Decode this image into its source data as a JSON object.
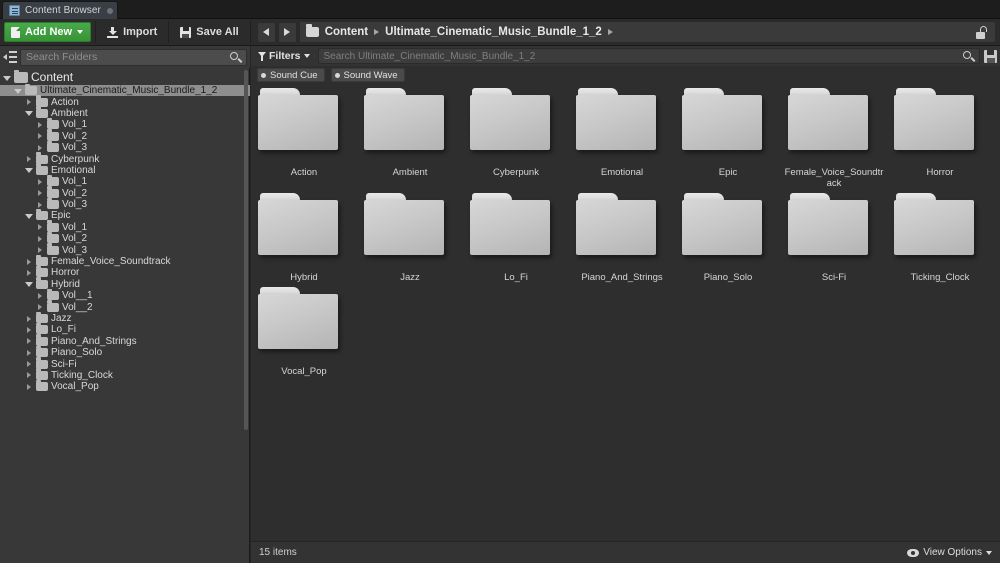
{
  "window": {
    "tab_label": "Content Browser",
    "tab_icon": "content-browser-icon"
  },
  "toolbar": {
    "add_new_label": "Add New",
    "import_label": "Import",
    "save_all_label": "Save All",
    "back_icon": "arrow-left-icon",
    "forward_icon": "arrow-right-icon",
    "lock_icon": "unlocked-padlock-icon"
  },
  "breadcrumb": {
    "folder_icon": "folder-icon",
    "items": [
      "Content",
      "Ultimate_Cinematic_Music_Bundle_1_2"
    ]
  },
  "folder_search": {
    "placeholder": "Search Folders",
    "search_icon": "search-icon",
    "collapse_icon": "collapse-all-icon"
  },
  "asset_search": {
    "filters_label": "Filters",
    "filter_icon": "funnel-icon",
    "placeholder": "Search Ultimate_Cinematic_Music_Bundle_1_2",
    "search_icon": "search-icon",
    "save_icon": "save-search-icon"
  },
  "filter_chips": [
    {
      "label": "Sound Cue"
    },
    {
      "label": "Sound Wave"
    }
  ],
  "tree": [
    {
      "label": "Content",
      "depth": 0,
      "state": "open",
      "selected": false,
      "root": true
    },
    {
      "label": "Ultimate_Cinematic_Music_Bundle_1_2",
      "depth": 1,
      "state": "open",
      "selected": true,
      "root": false
    },
    {
      "label": "Action",
      "depth": 2,
      "state": "closed",
      "selected": false,
      "root": false
    },
    {
      "label": "Ambient",
      "depth": 2,
      "state": "open",
      "selected": false,
      "root": false
    },
    {
      "label": "Vol_1",
      "depth": 3,
      "state": "closed",
      "selected": false,
      "root": false
    },
    {
      "label": "Vol_2",
      "depth": 3,
      "state": "closed",
      "selected": false,
      "root": false
    },
    {
      "label": "Vol_3",
      "depth": 3,
      "state": "closed",
      "selected": false,
      "root": false
    },
    {
      "label": "Cyberpunk",
      "depth": 2,
      "state": "closed",
      "selected": false,
      "root": false
    },
    {
      "label": "Emotional",
      "depth": 2,
      "state": "open",
      "selected": false,
      "root": false
    },
    {
      "label": "Vol_1",
      "depth": 3,
      "state": "closed",
      "selected": false,
      "root": false
    },
    {
      "label": "Vol_2",
      "depth": 3,
      "state": "closed",
      "selected": false,
      "root": false
    },
    {
      "label": "Vol_3",
      "depth": 3,
      "state": "closed",
      "selected": false,
      "root": false
    },
    {
      "label": "Epic",
      "depth": 2,
      "state": "open",
      "selected": false,
      "root": false
    },
    {
      "label": "Vol_1",
      "depth": 3,
      "state": "closed",
      "selected": false,
      "root": false
    },
    {
      "label": "Vol_2",
      "depth": 3,
      "state": "closed",
      "selected": false,
      "root": false
    },
    {
      "label": "Vol_3",
      "depth": 3,
      "state": "closed",
      "selected": false,
      "root": false
    },
    {
      "label": "Female_Voice_Soundtrack",
      "depth": 2,
      "state": "closed",
      "selected": false,
      "root": false
    },
    {
      "label": "Horror",
      "depth": 2,
      "state": "closed",
      "selected": false,
      "root": false
    },
    {
      "label": "Hybrid",
      "depth": 2,
      "state": "open",
      "selected": false,
      "root": false
    },
    {
      "label": "Vol__1",
      "depth": 3,
      "state": "closed",
      "selected": false,
      "root": false
    },
    {
      "label": "Vol__2",
      "depth": 3,
      "state": "closed",
      "selected": false,
      "root": false
    },
    {
      "label": "Jazz",
      "depth": 2,
      "state": "closed",
      "selected": false,
      "root": false
    },
    {
      "label": "Lo_Fi",
      "depth": 2,
      "state": "closed",
      "selected": false,
      "root": false
    },
    {
      "label": "Piano_And_Strings",
      "depth": 2,
      "state": "closed",
      "selected": false,
      "root": false
    },
    {
      "label": "Piano_Solo",
      "depth": 2,
      "state": "closed",
      "selected": false,
      "root": false
    },
    {
      "label": "Sci-Fi",
      "depth": 2,
      "state": "closed",
      "selected": false,
      "root": false
    },
    {
      "label": "Ticking_Clock",
      "depth": 2,
      "state": "closed",
      "selected": false,
      "root": false
    },
    {
      "label": "Vocal_Pop",
      "depth": 2,
      "state": "closed",
      "selected": false,
      "root": false
    }
  ],
  "tiles": [
    {
      "label": "Action"
    },
    {
      "label": "Ambient"
    },
    {
      "label": "Cyberpunk"
    },
    {
      "label": "Emotional"
    },
    {
      "label": "Epic"
    },
    {
      "label": "Female_Voice_Soundtrack"
    },
    {
      "label": "Horror"
    },
    {
      "label": "Hybrid"
    },
    {
      "label": "Jazz"
    },
    {
      "label": "Lo_Fi"
    },
    {
      "label": "Piano_And_Strings"
    },
    {
      "label": "Piano_Solo"
    },
    {
      "label": "Sci-Fi"
    },
    {
      "label": "Ticking_Clock"
    },
    {
      "label": "Vocal_Pop"
    }
  ],
  "status": {
    "item_count": "15 items",
    "view_options_label": "View Options",
    "eye_icon": "eye-icon"
  },
  "colors": {
    "accent_green": "#3d8c3d",
    "panel_bg": "#383838",
    "tile_bg": "#2e2e2e",
    "selection": "#8e8e8e"
  }
}
